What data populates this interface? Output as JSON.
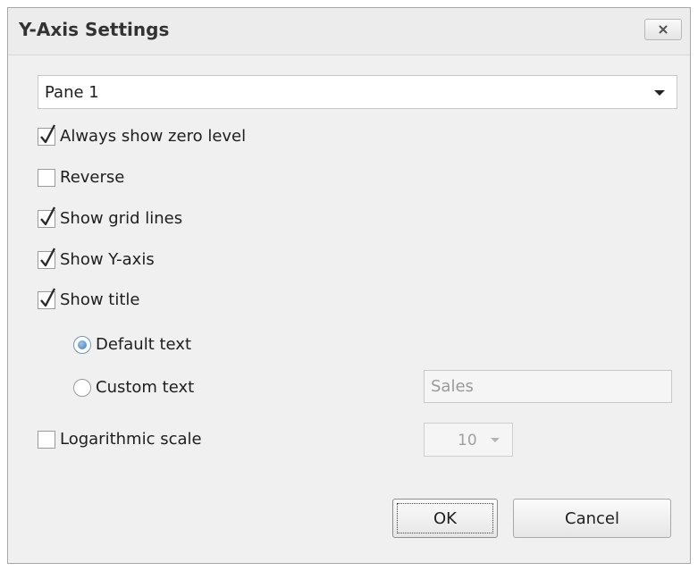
{
  "dialog": {
    "title": "Y-Axis Settings"
  },
  "pane_select": {
    "value": "Pane 1"
  },
  "options": {
    "always_show_zero_level": {
      "label": "Always show zero level",
      "checked": true
    },
    "reverse": {
      "label": "Reverse",
      "checked": false
    },
    "show_grid_lines": {
      "label": "Show grid lines",
      "checked": true
    },
    "show_y_axis": {
      "label": "Show Y-axis",
      "checked": true
    },
    "show_title": {
      "label": "Show title",
      "checked": true
    },
    "default_text": {
      "label": "Default text",
      "selected": true
    },
    "custom_text": {
      "label": "Custom text",
      "selected": false
    },
    "custom_text_value": "Sales",
    "logarithmic_scale": {
      "label": "Logarithmic scale",
      "checked": false
    },
    "log_base": "10"
  },
  "buttons": {
    "ok": "OK",
    "cancel": "Cancel"
  },
  "icons": {
    "close": "close-icon",
    "dropdown": "chevron-down-icon",
    "check": "checkmark-icon"
  },
  "colors": {
    "dialog_bg": "#f0f0f0",
    "radio_selected": "#3b78c4",
    "disabled_text": "#9a9a9a"
  }
}
